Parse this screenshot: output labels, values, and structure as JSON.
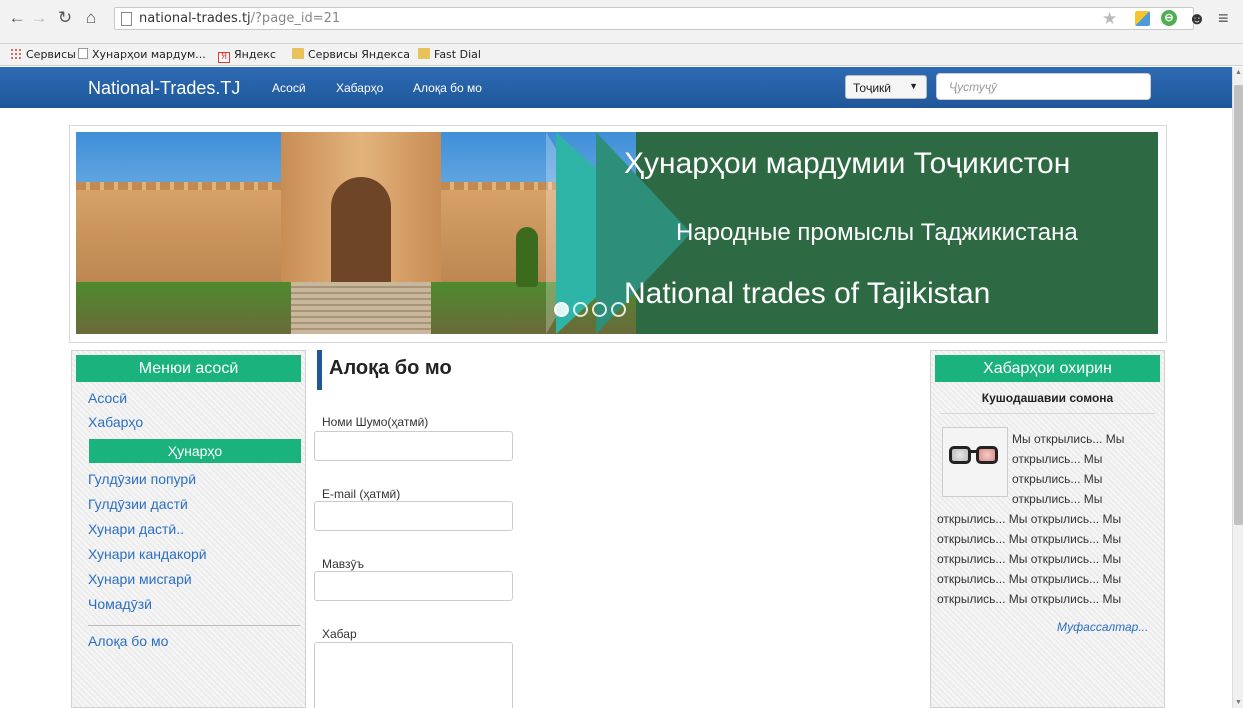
{
  "browser": {
    "url_host": "national-trades.tj",
    "url_path": "/?page_id=21",
    "bookmarks": [
      {
        "label": "Сервисы",
        "icon": "apps-icon"
      },
      {
        "label": "Хунарҳои мардум...",
        "icon": "page-icon"
      },
      {
        "label": "Яндекс",
        "icon": "yandex-icon"
      },
      {
        "label": "Сервисы Яндекса",
        "icon": "folder-icon"
      },
      {
        "label": "Fast Dial",
        "icon": "folder-icon"
      }
    ]
  },
  "navbar": {
    "brand": "National-Trades.TJ",
    "links": [
      "Асосӣ",
      "Хабарҳо",
      "Алоқа бо мо"
    ],
    "language": "Тоҷикӣ",
    "search_placeholder": "Ҷустуҷӯ",
    "color": "#1f5799"
  },
  "banner": {
    "line1": "Ҳунарҳои мардумии Тоҷикистон",
    "line2": "Народные промыслы Таджикистана",
    "line3": "National trades of Tajikistan",
    "slides": 4,
    "active_slide": 1
  },
  "left_menu": {
    "title": "Менюи асосӣ",
    "top_items": [
      "Асосӣ",
      "Хабарҳо"
    ],
    "sub_title": "Ҳунарҳо",
    "craft_items": [
      "Гулдӯзии попурӣ",
      "Гулдӯзии дастӣ",
      "Хунари дастӣ..",
      "Хунари кандакорӣ",
      "Хунари мисгарӣ",
      "Чомадӯзӣ"
    ],
    "bottom_item": "Алоқа бо мо",
    "accent": "#1bb37d"
  },
  "content": {
    "title": "Алоқа бо мо",
    "fields": {
      "name_label": "Номи Шумо(ҳатмӣ)",
      "email_label": "E-mail (ҳатмӣ)",
      "subject_label": "Мавзӯъ",
      "message_label": "Хабар"
    }
  },
  "news": {
    "title": "Хабарҳои охирин",
    "item_title": "Кушодашавии сомона",
    "item_text": "Мы открылись... Мы открылись... Мы открылись... Мы открылись... Мы открылись... Мы открылись... Мы открылись... Мы открылись... Мы открылись... Мы открылись... Мы открылись... Мы открылись... Мы открылись... Мы открылись... Мы",
    "more_label": "Муфассалтар..."
  }
}
